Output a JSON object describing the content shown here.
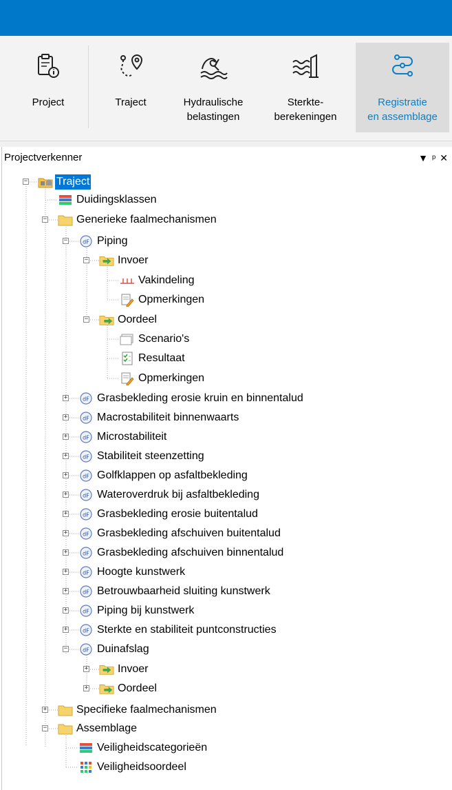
{
  "ribbon": {
    "buttons": [
      {
        "label": "Project",
        "icon": "project-icon"
      },
      {
        "label": "Traject",
        "icon": "traject-icon"
      },
      {
        "label": "Hydraulische\nbelastingen",
        "icon": "hydraulic-icon"
      },
      {
        "label": "Sterkte-\nberekeningen",
        "icon": "strength-icon"
      },
      {
        "label": "Registratie\nen assemblage",
        "icon": "registration-icon",
        "active": true
      }
    ]
  },
  "panel": {
    "title": "Projectverkenner",
    "buttons": [
      "▼",
      "ᵖ",
      "✕"
    ]
  },
  "tree": {
    "traject": "Traject",
    "duidingsklassen": "Duidingsklassen",
    "generieke": "Generieke faalmechanismen",
    "piping": "Piping",
    "piping_invoer": "Invoer",
    "vakindeling": "Vakindeling",
    "opmerkingen1": "Opmerkingen",
    "piping_oordeel": "Oordeel",
    "scenarios": "Scenario's",
    "resultaat": "Resultaat",
    "opmerkingen2": "Opmerkingen",
    "mechanisms": [
      "Grasbekleding erosie kruin en binnentalud",
      "Macrostabiliteit binnenwaarts",
      "Microstabiliteit",
      "Stabiliteit steenzetting",
      "Golfklappen op asfaltbekleding",
      "Wateroverdruk bij asfaltbekleding",
      "Grasbekleding erosie buitentalud",
      "Grasbekleding afschuiven buitentalud",
      "Grasbekleding afschuiven binnentalud",
      "Hoogte kunstwerk",
      "Betrouwbaarheid sluiting kunstwerk",
      "Piping bij kunstwerk",
      "Sterkte en stabiliteit puntconstructies"
    ],
    "duinafslag": "Duinafslag",
    "duin_invoer": "Invoer",
    "duin_oordeel": "Oordeel",
    "specifieke": "Specifieke faalmechanismen",
    "assemblage": "Assemblage",
    "veiligheidscategorieen": "Veiligheidscategorieën",
    "veiligheidsoordeel": "Veiligheidsoordeel"
  },
  "colors": {
    "titlebar": "#0078c9",
    "selection": "#0078d7",
    "active_ribbon_text": "#0a7fc8"
  }
}
